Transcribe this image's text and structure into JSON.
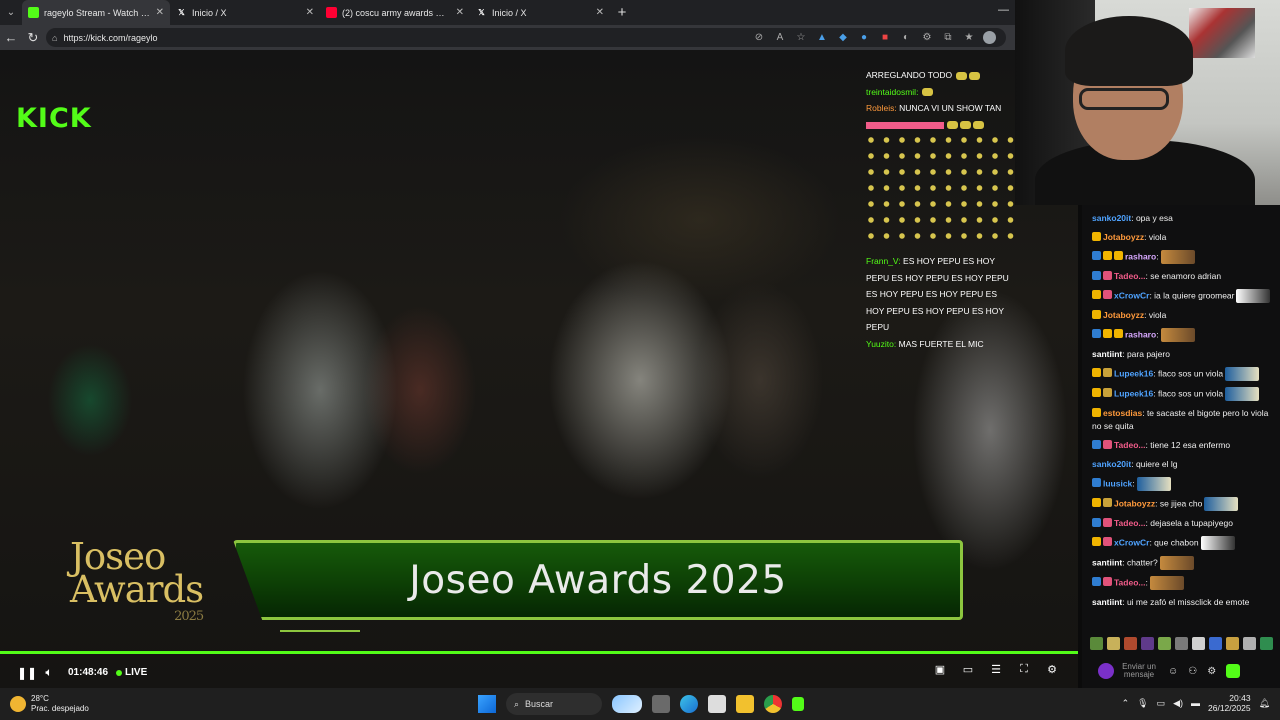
{
  "browser": {
    "tabs": [
      {
        "title": "rageylo Stream - Watch Live o",
        "active": true,
        "favicon": "kick-icon",
        "favicon_color": "#53fc18"
      },
      {
        "title": "Inicio / X",
        "active": false,
        "favicon": "x-icon",
        "favicon_color": "#ffffff"
      },
      {
        "title": "(2) coscu army awards musica - Yo",
        "active": false,
        "favicon": "youtube-icon",
        "favicon_color": "#ff0033"
      },
      {
        "title": "Inicio / X",
        "active": false,
        "favicon": "x-icon",
        "favicon_color": "#ffffff"
      }
    ],
    "new_tab": "+",
    "minimize": "—",
    "url": "https://kick.com/rageylo"
  },
  "video": {
    "kick_logo": "KICK",
    "overlay_chat": [
      {
        "user": "",
        "text": "ARREGLANDO TODO",
        "color": "#ffffff"
      },
      {
        "user": "treintaidosmil:",
        "text": "",
        "color": "#ffffff"
      },
      {
        "user": "Robleis:",
        "text": "NUNCA VI UN SHOW TAN",
        "color": "#ff9a3c"
      },
      {
        "user": "",
        "text": "",
        "color": "#f25c8a"
      }
    ],
    "overlay_chat_2": [
      {
        "user": "Frann_V:",
        "text": "ES HOY PEPU  ES HOY PEPU  ES HOY PEPU  ES HOY PEPU  ES HOY PEPU  ES HOY PEPU  ES HOY PEPU  ES HOY PEPU  ES HOY PEPU"
      },
      {
        "user": "Yuuzito:",
        "text": "MAS FUERTE EL MIC"
      }
    ],
    "awards_logo_line1": "Joseo",
    "awards_logo_line2": "Awards",
    "awards_logo_year": "2025",
    "banner_title": "Joseo Awards 2025",
    "accent": "#53fc18"
  },
  "player": {
    "time": "01:48:46",
    "live_label": "LIVE",
    "icons": [
      "pause-icon",
      "volume-icon",
      "miniplayer-icon",
      "theater-icon",
      "layout-icon",
      "fullscreen-icon",
      "settings-icon"
    ]
  },
  "chat": {
    "messages": [
      {
        "user": "sanko20it",
        "text": ": opa y esa",
        "color": "#4fa3ff",
        "badges": []
      },
      {
        "user": "Jotaboyzz",
        "text": ": viola",
        "color": "#ff9a3c",
        "badges": [
          "#f0b400"
        ]
      },
      {
        "user": "rasharo",
        "text": ":",
        "color": "#d8a8ff",
        "badges": [
          "#2f7dd1",
          "#f0b400",
          "#f0b400"
        ],
        "img": "orange"
      },
      {
        "user": "Tadeo...",
        "text": ": se enamoro adrian",
        "color": "#f25c8a",
        "badges": [
          "#2f7dd1",
          "#e0527a"
        ]
      },
      {
        "user": "xCrowCr",
        "text": ": ia la quiere groomear",
        "color": "#4fa3ff",
        "badges": [
          "#f0b400",
          "#e0527a"
        ],
        "img": "car"
      },
      {
        "user": "Jotaboyzz",
        "text": ": viola",
        "color": "#ff9a3c",
        "badges": [
          "#f0b400"
        ]
      },
      {
        "user": "rasharo",
        "text": ":",
        "color": "#d8a8ff",
        "badges": [
          "#2f7dd1",
          "#f0b400",
          "#f0b400"
        ],
        "img": "orange"
      },
      {
        "user": "santiint",
        "text": ": para pajero",
        "color": "#ffffff",
        "badges": []
      },
      {
        "user": "Lupeek16",
        "text": ": flaco sos un viola",
        "color": "#4fa3ff",
        "badges": [
          "#f0b400",
          "#c9a23a"
        ],
        "img": "blue"
      },
      {
        "user": "Lupeek16",
        "text": ": flaco sos un viola",
        "color": "#4fa3ff",
        "badges": [
          "#f0b400",
          "#c9a23a"
        ],
        "img": "blue"
      },
      {
        "user": "estosdias",
        "text": ": te sacaste el bigote pero lo viola no se quita",
        "color": "#ff9a3c",
        "badges": [
          "#f0b400"
        ]
      },
      {
        "user": "Tadeo...",
        "text": ": tiene 12 esa enfermo",
        "color": "#f25c8a",
        "badges": [
          "#2f7dd1",
          "#e0527a"
        ]
      },
      {
        "user": "sanko20it",
        "text": ": quiere el lg",
        "color": "#4fa3ff",
        "badges": []
      },
      {
        "user": "luusick",
        "text": ":",
        "color": "#4fa3ff",
        "badges": [
          "#2f7dd1"
        ],
        "img": "blue"
      },
      {
        "user": "Jotaboyzz",
        "text": ": se jijea cho",
        "color": "#ff9a3c",
        "badges": [
          "#f0b400",
          "#c9a23a"
        ],
        "img": "blue"
      },
      {
        "user": "Tadeo...",
        "text": ": dejasela a tupapiyego",
        "color": "#f25c8a",
        "badges": [
          "#2f7dd1",
          "#e0527a"
        ]
      },
      {
        "user": "xCrowCr",
        "text": ": que chabon",
        "color": "#4fa3ff",
        "badges": [
          "#f0b400",
          "#e0527a"
        ],
        "img": "car"
      },
      {
        "user": "santiint",
        "text": ": chatter?",
        "color": "#ffffff",
        "badges": [],
        "img": "orange"
      },
      {
        "user": "Tadeo...",
        "text": ":",
        "color": "#f25c8a",
        "badges": [
          "#2f7dd1",
          "#e0527a"
        ],
        "img": "orange"
      },
      {
        "user": "santiint",
        "text": ": ui me zafó el missclick de emote",
        "color": "#ffffff",
        "badges": []
      }
    ],
    "emote_bar": [
      "#5a8a3a",
      "#c8b15a",
      "#b04a2e",
      "#5f3a8a",
      "#7aa84a",
      "#7a7a7a",
      "#d0d0d0",
      "#3a6ad0",
      "#c8a040",
      "#b0b0b0",
      "#2f8d4f"
    ],
    "input_placeholder": "Enviar un mensaje",
    "send_color": "#53fc18"
  },
  "taskbar": {
    "temperature": "28°C",
    "weather": "Prac. despejado",
    "search": "Buscar",
    "time": "20:43",
    "date": "26/12/2025"
  }
}
